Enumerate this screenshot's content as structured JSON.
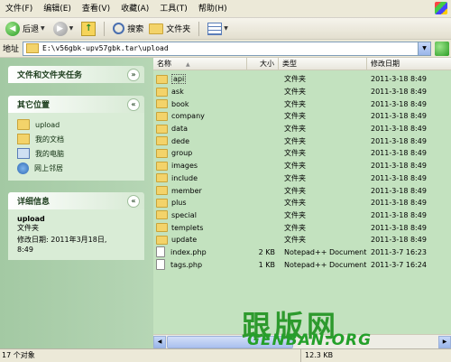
{
  "menu": [
    "文件(F)",
    "编辑(E)",
    "查看(V)",
    "收藏(A)",
    "工具(T)",
    "帮助(H)"
  ],
  "toolbar": {
    "back": "后退",
    "search": "搜索",
    "folders": "文件夹"
  },
  "address": {
    "label": "地址",
    "path": "E:\\v56gbk-upv57gbk.tar\\upload"
  },
  "tasks": {
    "file_tasks_title": "文件和文件夹任务",
    "other_places_title": "其它位置",
    "other_places": [
      "upload",
      "我的文档",
      "我的电脑",
      "网上邻居"
    ],
    "details_title": "详细信息",
    "details_name": "upload",
    "details_type": "文件夹",
    "details_modified_line1": "修改日期: 2011年3月18日,",
    "details_modified_line2": "8:49"
  },
  "columns": {
    "name": "名称",
    "size": "大小",
    "type": "类型",
    "modified": "修改日期"
  },
  "files": [
    {
      "name": "api",
      "size": "",
      "type": "文件夹",
      "modified": "2011-3-18  8:49",
      "kind": "folder"
    },
    {
      "name": "ask",
      "size": "",
      "type": "文件夹",
      "modified": "2011-3-18  8:49",
      "kind": "folder"
    },
    {
      "name": "book",
      "size": "",
      "type": "文件夹",
      "modified": "2011-3-18  8:49",
      "kind": "folder"
    },
    {
      "name": "company",
      "size": "",
      "type": "文件夹",
      "modified": "2011-3-18  8:49",
      "kind": "folder"
    },
    {
      "name": "data",
      "size": "",
      "type": "文件夹",
      "modified": "2011-3-18  8:49",
      "kind": "folder"
    },
    {
      "name": "dede",
      "size": "",
      "type": "文件夹",
      "modified": "2011-3-18  8:49",
      "kind": "folder"
    },
    {
      "name": "group",
      "size": "",
      "type": "文件夹",
      "modified": "2011-3-18  8:49",
      "kind": "folder"
    },
    {
      "name": "images",
      "size": "",
      "type": "文件夹",
      "modified": "2011-3-18  8:49",
      "kind": "folder"
    },
    {
      "name": "include",
      "size": "",
      "type": "文件夹",
      "modified": "2011-3-18  8:49",
      "kind": "folder"
    },
    {
      "name": "member",
      "size": "",
      "type": "文件夹",
      "modified": "2011-3-18  8:49",
      "kind": "folder"
    },
    {
      "name": "plus",
      "size": "",
      "type": "文件夹",
      "modified": "2011-3-18  8:49",
      "kind": "folder"
    },
    {
      "name": "special",
      "size": "",
      "type": "文件夹",
      "modified": "2011-3-18  8:49",
      "kind": "folder"
    },
    {
      "name": "templets",
      "size": "",
      "type": "文件夹",
      "modified": "2011-3-18  8:49",
      "kind": "folder"
    },
    {
      "name": "update",
      "size": "",
      "type": "文件夹",
      "modified": "2011-3-18  8:49",
      "kind": "folder"
    },
    {
      "name": "index.php",
      "size": "2 KB",
      "type": "Notepad++ Document",
      "modified": "2011-3-7  16:23",
      "kind": "file"
    },
    {
      "name": "tags.php",
      "size": "1 KB",
      "type": "Notepad++ Document",
      "modified": "2011-3-7  16:24",
      "kind": "file"
    }
  ],
  "status": {
    "count": "17 个对象",
    "size": "12.3 KB"
  },
  "watermark": {
    "main": "跟版网",
    "sub": "GENBAN.ORG"
  }
}
